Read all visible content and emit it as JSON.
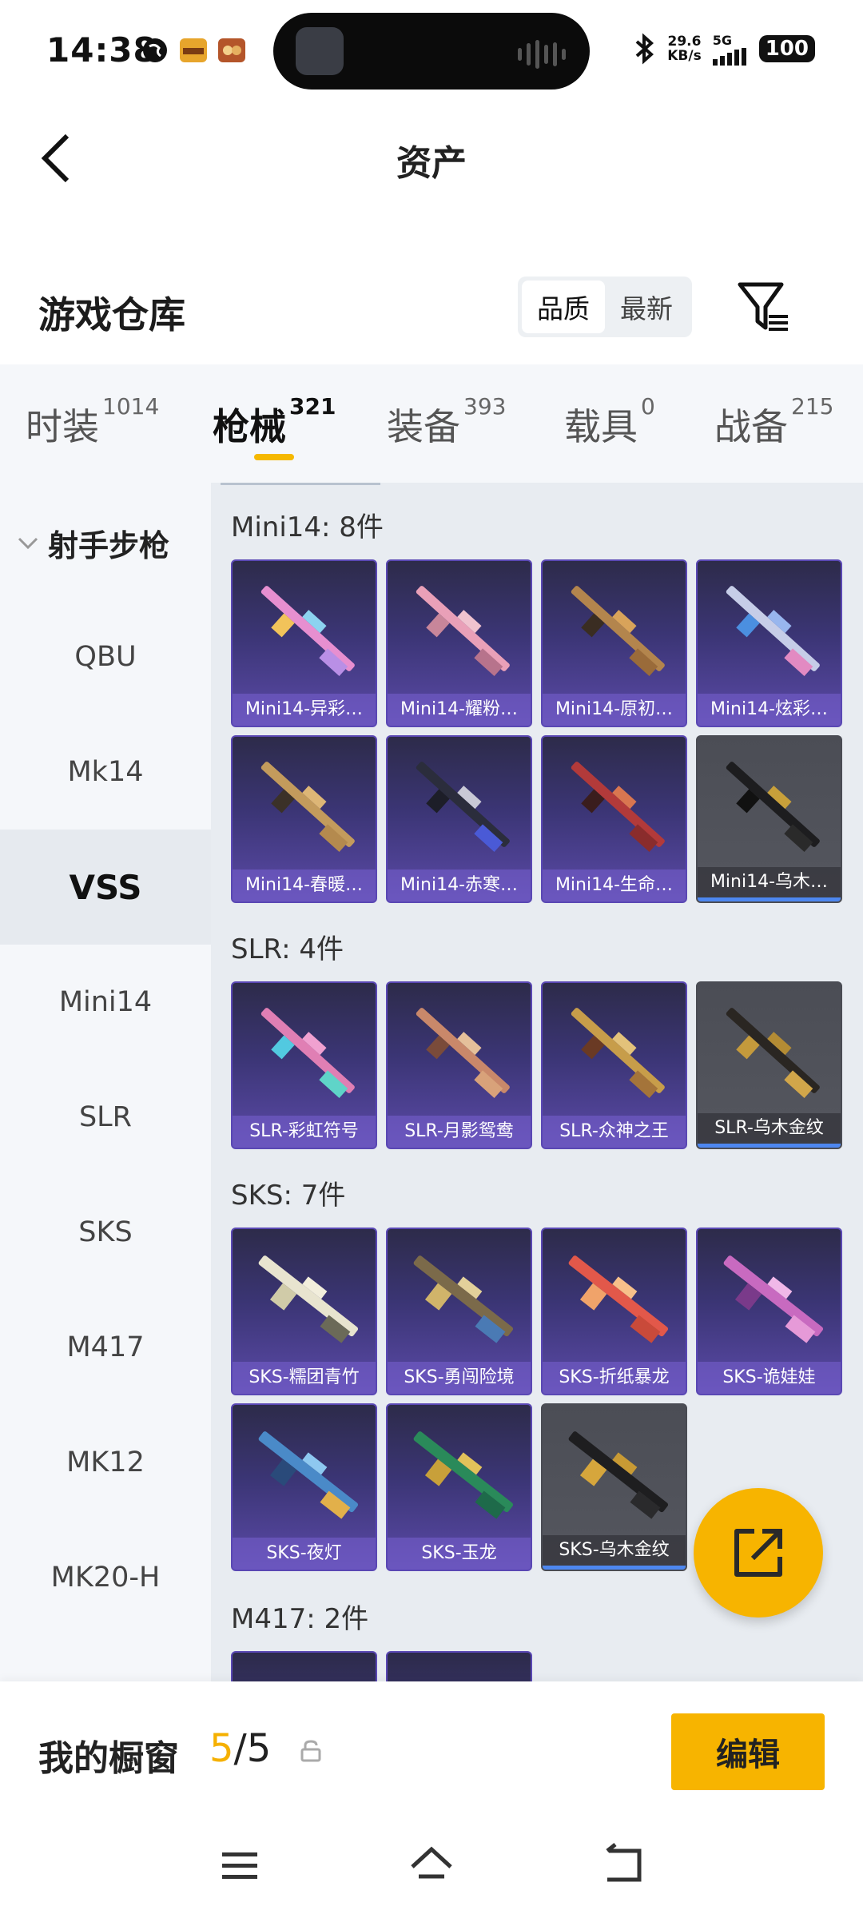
{
  "status_bar": {
    "time": "14:38",
    "net_speed_value": "29.6",
    "net_speed_unit": "KB/s",
    "network_type": "5G",
    "battery": "100"
  },
  "header": {
    "title": "资产"
  },
  "warehouse": {
    "title": "游戏仓库",
    "sort_options": [
      "品质",
      "最新"
    ],
    "sort_active": "品质"
  },
  "tabs": [
    {
      "label": "时装",
      "count": "1014"
    },
    {
      "label": "枪械",
      "count": "321"
    },
    {
      "label": "装备",
      "count": "393"
    },
    {
      "label": "载具",
      "count": "0"
    },
    {
      "label": "战备",
      "count": "215"
    }
  ],
  "side_menu": {
    "header": "射手步枪",
    "items": [
      "QBU",
      "Mk14",
      "VSS",
      "Mini14",
      "SLR",
      "SKS",
      "M417",
      "MK12",
      "MK20-H"
    ],
    "active": "VSS"
  },
  "sections": [
    {
      "label": "Mini14: 8件",
      "items": [
        "Mini14-异彩…",
        "Mini14-耀粉…",
        "Mini14-原初…",
        "Mini14-炫彩…",
        "Mini14-春暖…",
        "Mini14-赤寒…",
        "Mini14-生命…",
        "Mini14-乌木…"
      ]
    },
    {
      "label": "SLR: 4件",
      "items": [
        "SLR-彩虹符号",
        "SLR-月影鸳鸯",
        "SLR-众神之王",
        "SLR-乌木金纹"
      ]
    },
    {
      "label": "SKS: 7件",
      "items": [
        "SKS-糯团青竹",
        "SKS-勇闯险境",
        "SKS-折纸暴龙",
        "SKS-诡娃娃",
        "SKS-夜灯",
        "SKS-玉龙",
        "SKS-乌木金纹"
      ]
    },
    {
      "label": "M417: 2件",
      "items": [
        "",
        ""
      ]
    }
  ],
  "bottom": {
    "showcase_label": "我的橱窗",
    "showcase_current": "5",
    "showcase_sep_total": "/5",
    "edit_label": "编辑"
  },
  "colors": {
    "accent": "#f7b400",
    "card_purple": "#5a48b4",
    "card_gray": "#4b4d55",
    "background_gray": "#f5f7fa"
  }
}
